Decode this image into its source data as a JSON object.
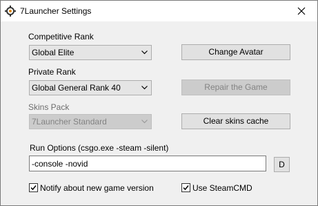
{
  "window": {
    "title": "7Launcher Settings",
    "app_icon": "7launcher-logo-icon",
    "close_icon": "close-icon"
  },
  "competitive_rank": {
    "label": "Competitive Rank",
    "selected": "Global Elite"
  },
  "private_rank": {
    "label": "Private Rank",
    "selected": "Global General Rank 40"
  },
  "skins_pack": {
    "label": "Skins Pack",
    "selected": "7Launcher Standard",
    "enabled": false
  },
  "buttons": {
    "change_avatar": "Change Avatar",
    "repair_game": "Repair the Game",
    "clear_skins_cache": "Clear skins cache"
  },
  "run_options": {
    "label": "Run Options (csgo.exe -steam -silent)",
    "value": "-console -novid",
    "d_button": "D"
  },
  "checkboxes": {
    "notify": {
      "label": "Notify about new game version",
      "checked": true
    },
    "steamcmd": {
      "label": "Use SteamCMD",
      "checked": true
    }
  }
}
